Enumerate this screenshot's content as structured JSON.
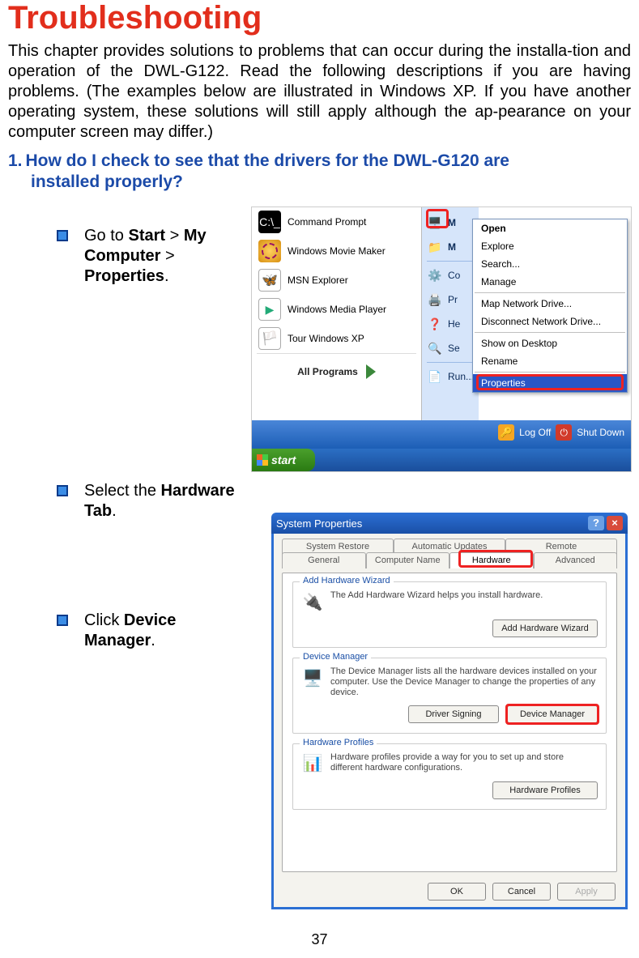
{
  "title": "Troubleshooting",
  "intro": "This chapter provides solutions to problems that can occur during the installa-tion and operation of the DWL-G122. Read the following descriptions if you are having problems. (The examples below are illustrated in Windows XP. If you have another operating system, these solutions will still apply although the ap-pearance on your computer screen may differ.)",
  "question": {
    "num": "1.",
    "line1": "How do I check to see that the drivers for the DWL-G120 are",
    "line2": "installed properly?"
  },
  "steps": {
    "s1_pre": "Go to ",
    "s1_b1": "Start",
    "s1_mid1": " > ",
    "s1_b2": "My Computer",
    "s1_mid2": " > ",
    "s1_b3": "Properties",
    "s1_post": ".",
    "s2_pre": "Select the ",
    "s2_b1": "Hardware Tab",
    "s2_post": ".",
    "s3_pre": "Click ",
    "s3_b1": "Device Manager",
    "s3_post": "."
  },
  "shot1": {
    "left": {
      "cmd": "Command Prompt",
      "cmd_icon_text": "C:\\_",
      "wmm": "Windows Movie Maker",
      "msn": "MSN Explorer",
      "wmp": "Windows Media Player",
      "tour": "Tour Windows XP",
      "all": "All Programs"
    },
    "right": {
      "my": "M",
      "co": "Co",
      "pr": "Pr",
      "he": "He",
      "se": "Se",
      "run": "Run..."
    },
    "logoff": "Log Off",
    "shutdown": "Shut Down",
    "start": "start",
    "ctx": {
      "open": "Open",
      "explore": "Explore",
      "search": "Search...",
      "manage": "Manage",
      "mapdrive": "Map Network Drive...",
      "disconnect": "Disconnect Network Drive...",
      "showdesk": "Show on Desktop",
      "rename": "Rename",
      "properties": "Properties"
    }
  },
  "shot2": {
    "title": "System Properties",
    "tabs": {
      "sysrestore": "System Restore",
      "autoupdate": "Automatic Updates",
      "remote": "Remote",
      "general": "General",
      "compname": "Computer Name",
      "hardware": "Hardware",
      "advanced": "Advanced"
    },
    "g1": {
      "title": "Add Hardware Wizard",
      "text": "The Add Hardware Wizard helps you install hardware.",
      "btn": "Add Hardware Wizard"
    },
    "g2": {
      "title": "Device Manager",
      "text": "The Device Manager lists all the hardware devices installed on your computer. Use the Device Manager to change the properties of any device.",
      "btn1": "Driver Signing",
      "btn2": "Device Manager"
    },
    "g3": {
      "title": "Hardware Profiles",
      "text": "Hardware profiles provide a way for you to set up and store different hardware configurations.",
      "btn": "Hardware Profiles"
    },
    "ok": "OK",
    "cancel": "Cancel",
    "apply": "Apply"
  },
  "page_number": "37"
}
